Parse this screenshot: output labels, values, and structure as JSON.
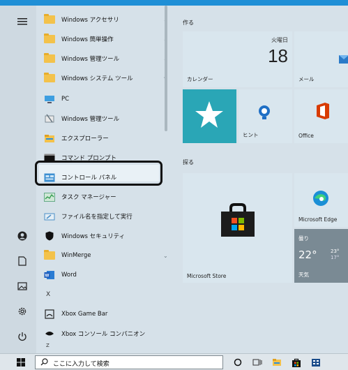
{
  "app_list": [
    {
      "label": "Windows アクセサリ",
      "chevron": "⌄"
    },
    {
      "label": "Windows 簡単操作",
      "chevron": "⌄"
    },
    {
      "label": "Windows 管理ツール",
      "chevron": "⌄"
    },
    {
      "label": "Windows システム ツール",
      "chevron": "^"
    },
    {
      "label": "PC"
    },
    {
      "label": "Windows 管理ツール"
    },
    {
      "label": "エクスプローラー"
    },
    {
      "label": "コマンド プロンプト"
    },
    {
      "label": "コントロール パネル"
    },
    {
      "label": "タスク マネージャー"
    },
    {
      "label": "ファイル名を指定して実行"
    },
    {
      "label": "Windows セキュリティ"
    },
    {
      "label": "WinMerge",
      "chevron": "⌄"
    },
    {
      "label": "Word"
    },
    {
      "label": "X"
    },
    {
      "label": "Xbox Game Bar"
    },
    {
      "label": "Xbox コンソール コンパニオン"
    },
    {
      "label": "Z"
    }
  ],
  "tiles": {
    "section_create": "作る",
    "section_play": "探る",
    "calendar_day": "火曜日",
    "calendar_date": "18",
    "calendar_label": "カレンダー",
    "mail_label": "メール",
    "tips_label": "ヒント",
    "office_label": "Office",
    "store_label": "Microsoft Store",
    "edge_label": "Microsoft Edge",
    "weather_condition": "曇り",
    "weather_temp": "22°",
    "weather_high": "23°",
    "weather_low": "17°",
    "weather_label": "天気"
  },
  "search": {
    "placeholder": "ここに入力して検索"
  },
  "colors": {
    "accent": "#1f8fd6",
    "selection_border": "#111111",
    "tips_tile": "#2aa6b6",
    "weather_tile": "#7a8a94"
  }
}
